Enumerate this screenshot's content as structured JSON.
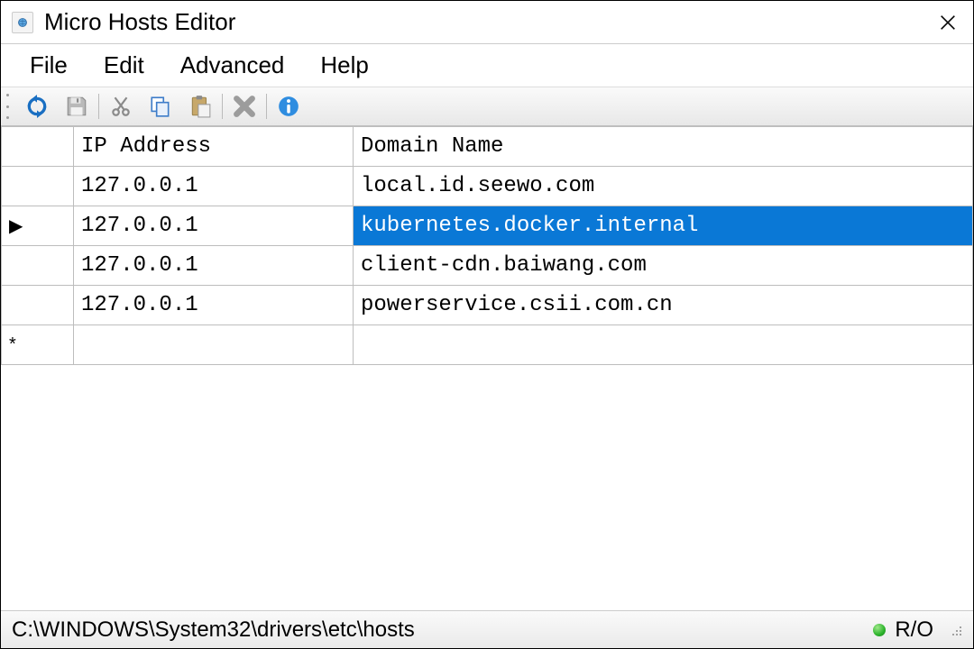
{
  "title": "Micro Hosts Editor",
  "menu": {
    "file": "File",
    "edit": "Edit",
    "advanced": "Advanced",
    "help": "Help"
  },
  "toolbar_icons": {
    "refresh": "refresh-icon",
    "save": "save-icon",
    "cut": "cut-icon",
    "copy": "copy-icon",
    "paste": "paste-icon",
    "delete": "delete-icon",
    "info": "info-icon"
  },
  "columns": {
    "ip": "IP Address",
    "domain": "Domain Name"
  },
  "rows": [
    {
      "ip": "127.0.0.1",
      "domain": "local.id.seewo.com",
      "selected": false,
      "current": false
    },
    {
      "ip": "127.0.0.1",
      "domain": "kubernetes.docker.internal",
      "selected": true,
      "current": true
    },
    {
      "ip": "127.0.0.1",
      "domain": "client-cdn.baiwang.com",
      "selected": false,
      "current": false
    },
    {
      "ip": "127.0.0.1",
      "domain": "powerservice.csii.com.cn",
      "selected": false,
      "current": false
    }
  ],
  "new_row_marker": "*",
  "current_row_marker": "▶",
  "status": {
    "path": "C:\\WINDOWS\\System32\\drivers\\etc\\hosts",
    "mode": "R/O",
    "indicator_color": "#2bb32b"
  }
}
